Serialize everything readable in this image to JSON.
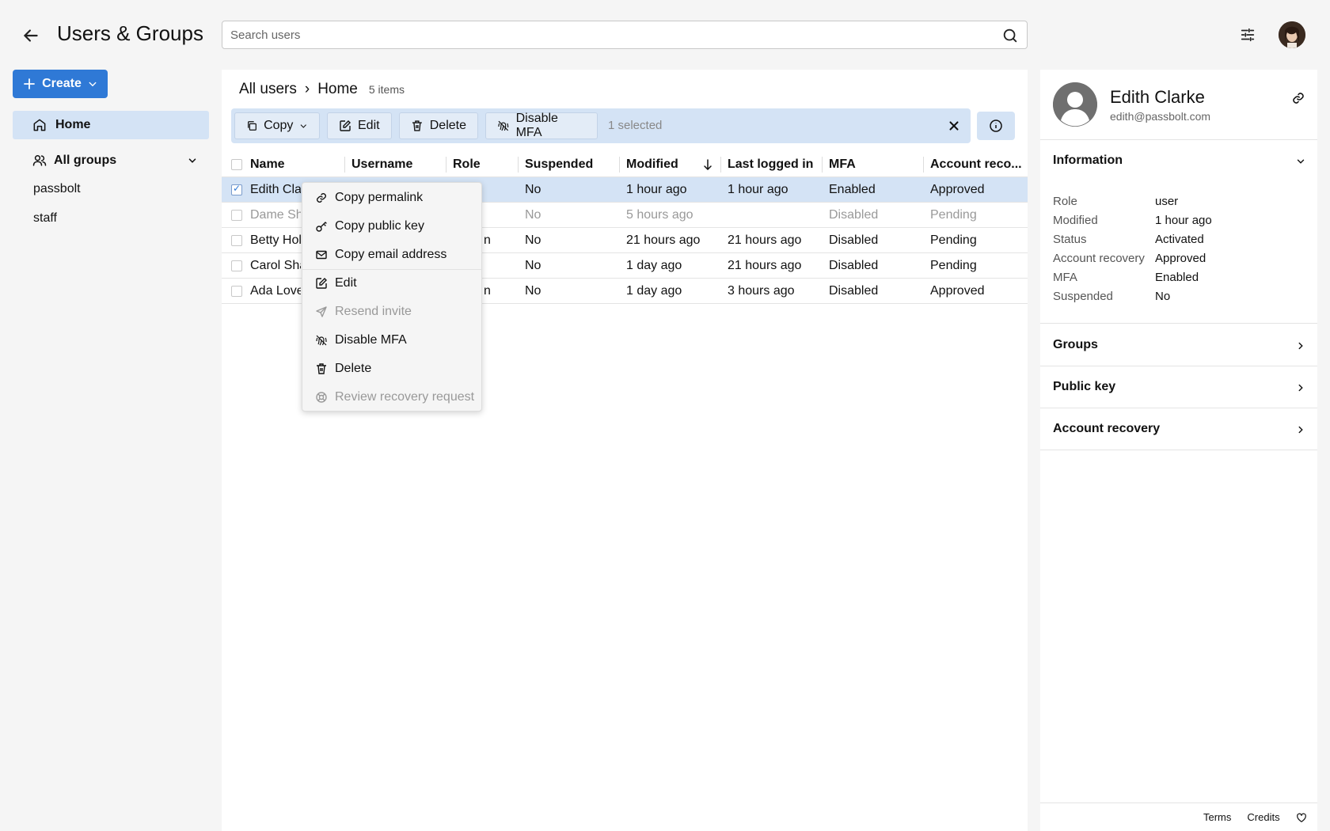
{
  "header": {
    "title": "Users & Groups",
    "search_placeholder": "Search users"
  },
  "nav": {
    "create_label": "Create",
    "home_label": "Home",
    "all_groups_label": "All groups",
    "groups": [
      "passbolt",
      "staff"
    ]
  },
  "main": {
    "breadcrumb_root": "All users",
    "breadcrumb_sep": "›",
    "breadcrumb_current": "Home",
    "item_count": "5 items",
    "actions": {
      "copy": "Copy",
      "edit": "Edit",
      "delete": "Delete",
      "disable_mfa": "Disable MFA",
      "selected": "1 selected"
    },
    "columns": [
      "Name",
      "Username",
      "Role",
      "Suspended",
      "Modified",
      "Last logged in",
      "MFA",
      "Account reco..."
    ],
    "rows": [
      {
        "name": "Edith Clar",
        "username": "",
        "role": "",
        "suspended": "No",
        "modified": "1 hour ago",
        "last_logged": "1 hour ago",
        "mfa": "Enabled",
        "recovery": "Approved"
      },
      {
        "name": "Dame Sh",
        "username": "",
        "role": "",
        "suspended": "No",
        "modified": "5 hours ago",
        "last_logged": "",
        "mfa": "Disabled",
        "recovery": "Pending"
      },
      {
        "name": "Betty Hol",
        "username": "",
        "role": "n",
        "suspended": "No",
        "modified": "21 hours ago",
        "last_logged": "21 hours ago",
        "mfa": "Disabled",
        "recovery": "Pending"
      },
      {
        "name": "Carol Sha",
        "username": "",
        "role": "",
        "suspended": "No",
        "modified": "1 day ago",
        "last_logged": "21 hours ago",
        "mfa": "Disabled",
        "recovery": "Pending"
      },
      {
        "name": "Ada Love",
        "username": "",
        "role": "n",
        "suspended": "No",
        "modified": "1 day ago",
        "last_logged": "3 hours ago",
        "mfa": "Disabled",
        "recovery": "Approved"
      }
    ]
  },
  "context_menu": {
    "copy_permalink": "Copy permalink",
    "copy_public_key": "Copy public key",
    "copy_email": "Copy email address",
    "edit": "Edit",
    "resend_invite": "Resend invite",
    "disable_mfa": "Disable MFA",
    "delete": "Delete",
    "review_recovery": "Review recovery request"
  },
  "sidebar": {
    "name": "Edith Clarke",
    "email": "edith@passbolt.com",
    "information_title": "Information",
    "info": {
      "role_label": "Role",
      "role": "user",
      "modified_label": "Modified",
      "modified": "1 hour ago",
      "status_label": "Status",
      "status": "Activated",
      "recovery_label": "Account recovery",
      "recovery": "Approved",
      "mfa_label": "MFA",
      "mfa": "Enabled",
      "suspended_label": "Suspended",
      "suspended": "No"
    },
    "groups_title": "Groups",
    "public_key_title": "Public key",
    "account_recovery_title": "Account recovery"
  },
  "footer": {
    "terms": "Terms",
    "credits": "Credits"
  },
  "colors": {
    "accent": "#2f79d6",
    "selection": "#d4e3f5"
  }
}
